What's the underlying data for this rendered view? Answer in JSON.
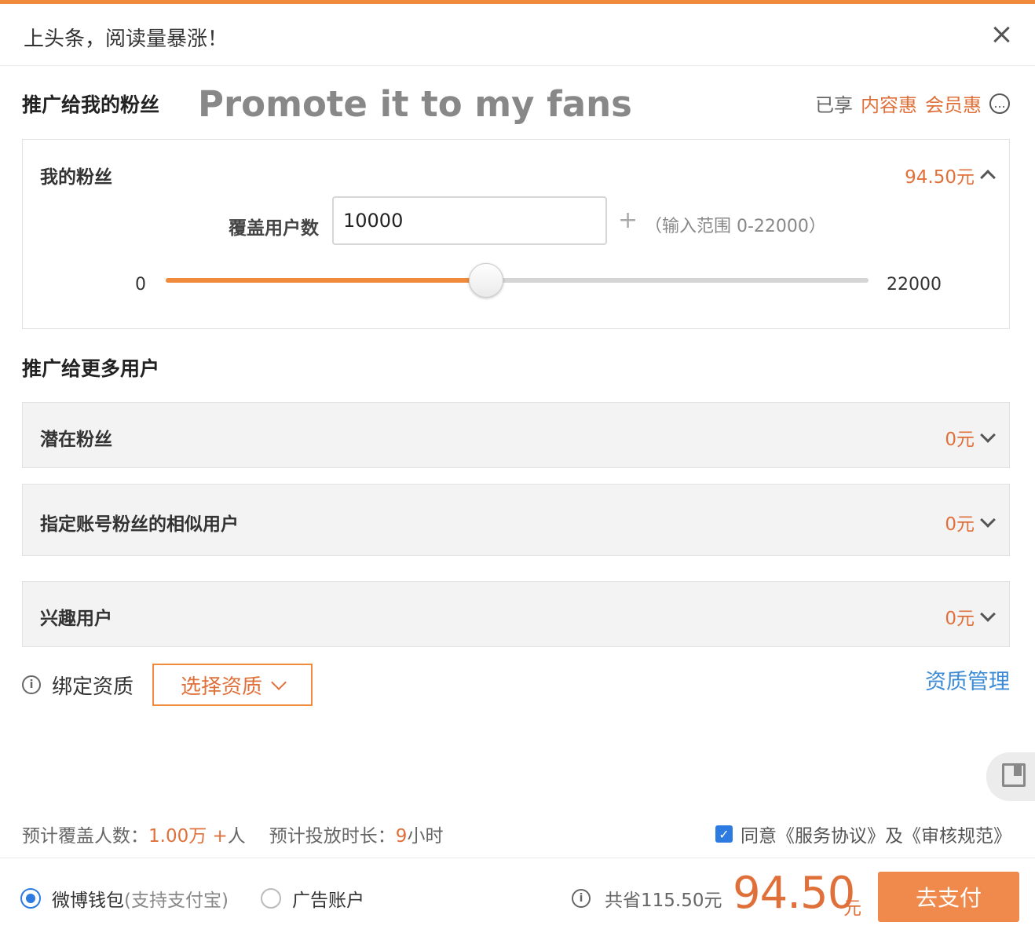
{
  "header": {
    "title": "上头条，阅读量暴涨！"
  },
  "promote_fans": {
    "title": "推广给我的粉丝",
    "overlay_caption": "Promote it to my fans",
    "discount_prefix": "已享",
    "discount_content": "内容惠",
    "discount_member": "会员惠",
    "more_icon": "..."
  },
  "my_fans": {
    "label": "我的粉丝",
    "price": "94.50元",
    "cover_label": "覆盖用户数",
    "cover_value": "10000",
    "plus": "+",
    "range_hint": "（输入范围 0-22000）",
    "slider_min": "0",
    "slider_max": "22000",
    "slider_value": 10000,
    "slider_range": [
      0,
      22000
    ]
  },
  "promote_more": {
    "title": "推广给更多用户",
    "items": [
      {
        "label": "潜在粉丝",
        "price": "0元"
      },
      {
        "label": "指定账号粉丝的相似用户",
        "price": "0元"
      },
      {
        "label": "兴趣用户",
        "price": "0元"
      }
    ]
  },
  "qualification": {
    "label": "绑定资质",
    "select_button": "选择资质",
    "manage_link": "资质管理",
    "info_icon": "i"
  },
  "estimate": {
    "cover_prefix": "预计覆盖人数：",
    "cover_value": "1.00万 +",
    "cover_unit": "人",
    "duration_prefix": "预计投放时长：",
    "duration_value": "9",
    "duration_unit": "小时"
  },
  "agreement": {
    "checked": true,
    "check_glyph": "✓",
    "text": "同意《服务协议》及《审核规范》"
  },
  "footer": {
    "wallet_label": "微博钱包",
    "wallet_sub": "(支持支付宝)",
    "ad_account_label": "广告账户",
    "save_text": "共省115.50元",
    "total_price": "94.50",
    "total_unit": "元",
    "pay_button": "去支付",
    "info_icon": "i"
  },
  "colors": {
    "accent_orange": "#f08a3c",
    "price_orange": "#e0703a",
    "link_blue": "#3d8bd4",
    "check_blue": "#2d7be0"
  }
}
